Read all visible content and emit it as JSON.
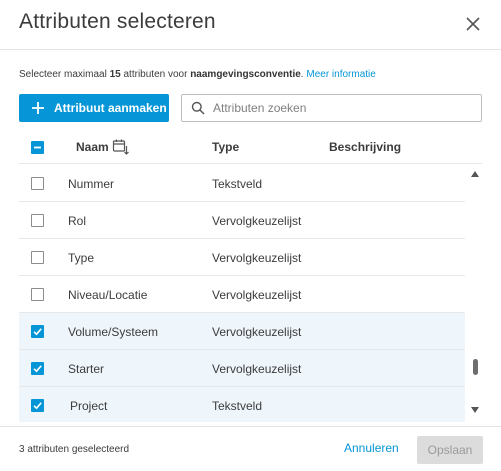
{
  "dialog": {
    "title": "Attributen selecteren",
    "description": {
      "prefix": "Selecteer maximaal ",
      "max": "15",
      "middle": " attributen voor ",
      "convention": "naamgevingsconventie",
      "suffix": ". ",
      "link": "Meer informatie"
    }
  },
  "toolbar": {
    "create_label": "Attribuut aanmaken",
    "search_placeholder": "Attributen zoeken"
  },
  "table": {
    "columns": {
      "name": "Naam",
      "type": "Type",
      "description": "Beschrijving"
    },
    "rows": [
      {
        "name": "Nummer",
        "type": "Tekstveld",
        "checked": false
      },
      {
        "name": "Rol",
        "type": "Vervolgkeuzelijst",
        "checked": false
      },
      {
        "name": "Type",
        "type": "Vervolgkeuzelijst",
        "checked": false
      },
      {
        "name": "Niveau/Locatie",
        "type": "Vervolgkeuzelijst",
        "checked": false
      },
      {
        "name": "Volume/Systeem",
        "type": "Vervolgkeuzelijst",
        "checked": true
      },
      {
        "name": "Starter",
        "type": "Vervolgkeuzelijst",
        "checked": true
      },
      {
        "name": "Project",
        "type": "Tekstveld",
        "checked": true
      }
    ]
  },
  "footer": {
    "selected_count": "3 attributen geselecteerd",
    "cancel_label": "Annuleren",
    "save_label": "Opslaan"
  },
  "colors": {
    "accent": "#0696d7",
    "selected_row": "#eef5fb",
    "disabled": "#dcdcdc"
  },
  "icons": {
    "close": "close-icon",
    "plus": "plus-icon",
    "search": "search-icon",
    "sort": "calendar-sort-icon"
  }
}
